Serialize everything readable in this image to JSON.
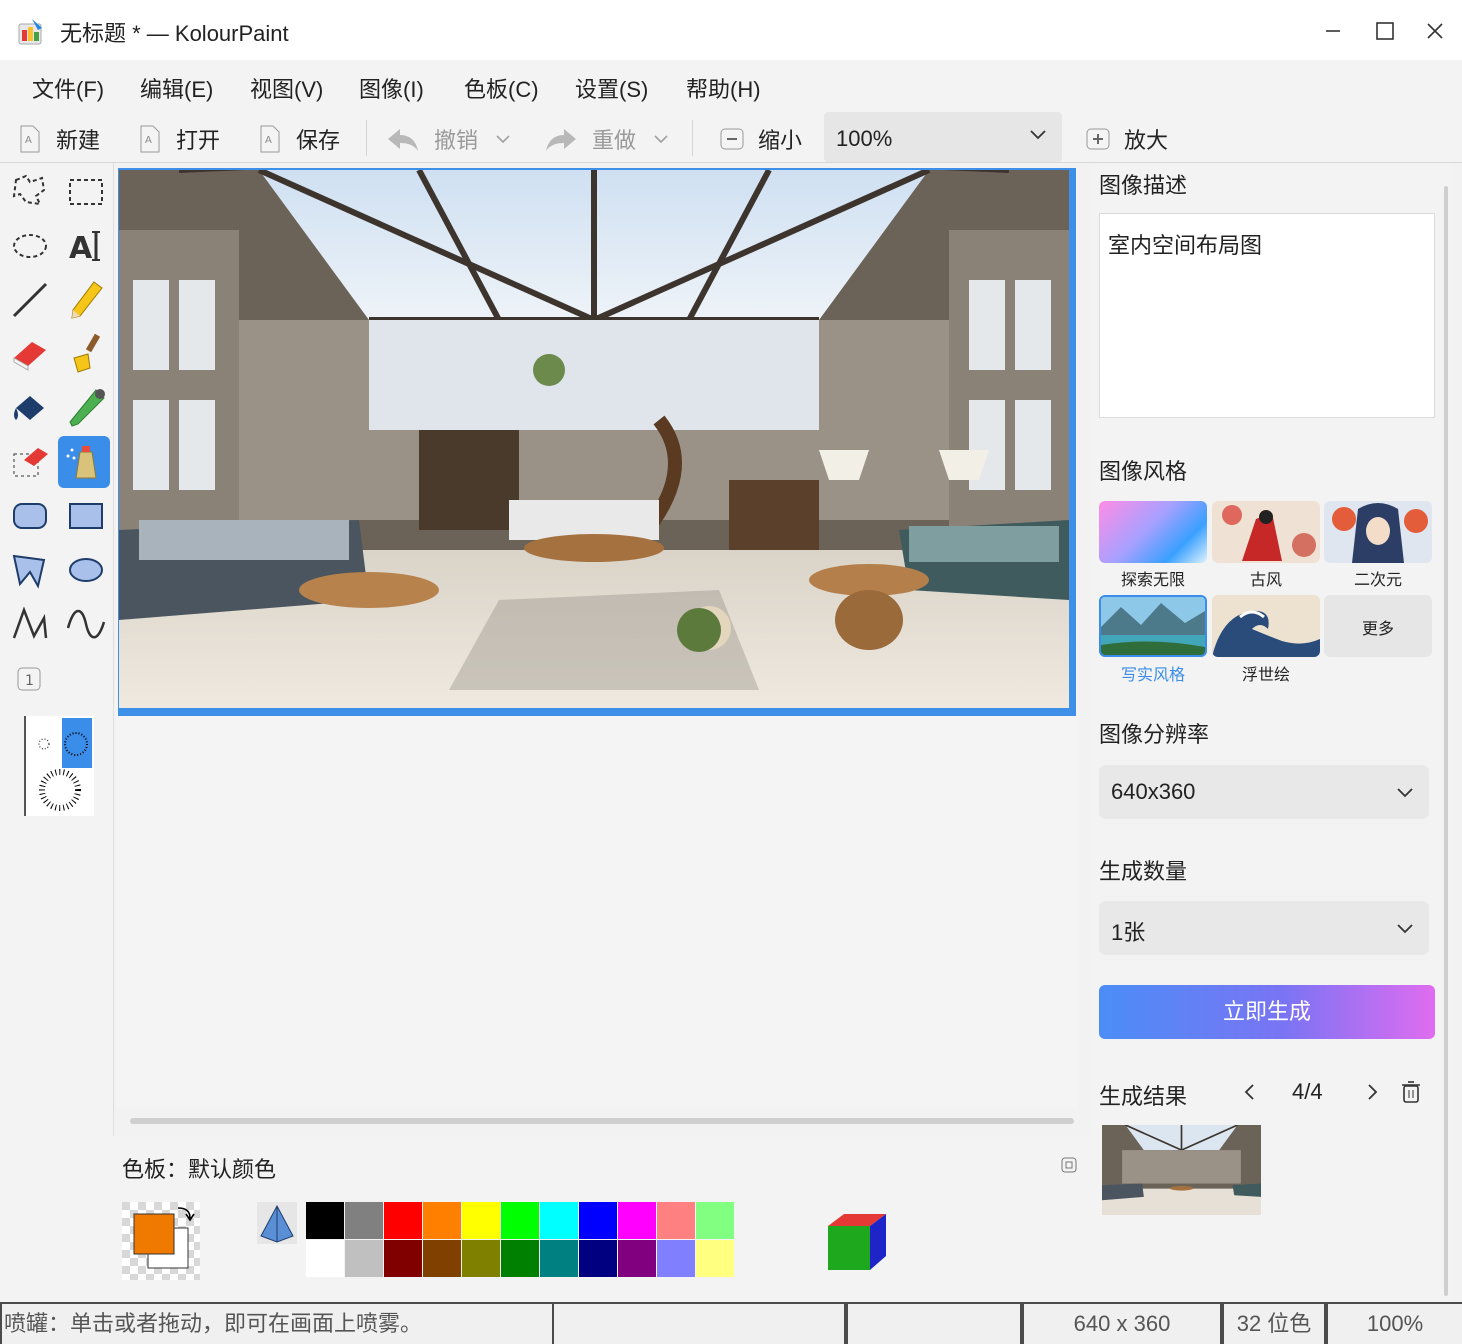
{
  "window": {
    "title": "无标题 * — KolourPaint",
    "controls": [
      "minimize",
      "maximize",
      "close"
    ]
  },
  "menu": [
    "文件(F)",
    "编辑(E)",
    "视图(V)",
    "图像(I)",
    "色板(C)",
    "设置(S)",
    "帮助(H)"
  ],
  "toolbar": {
    "new_label": "新建",
    "open_label": "打开",
    "save_label": "保存",
    "undo_label": "撤销",
    "redo_label": "重做",
    "zoom_out_label": "缩小",
    "zoom_value": "100%",
    "zoom_in_label": "放大"
  },
  "tools": [
    "free-form-select",
    "rectangle-select",
    "ellipse-select",
    "text",
    "line",
    "pen",
    "eraser",
    "brush",
    "flood-fill",
    "color-picker",
    "color-eraser",
    "spraycan",
    "rounded-rectangle",
    "rectangle",
    "polygon",
    "ellipse",
    "connected-lines",
    "curve"
  ],
  "active_tool": "spraycan",
  "palette": {
    "label": "色板：默认颜色",
    "foreground": "#f07a00",
    "background": "#ffffff",
    "colors_top": [
      "#000000",
      "#808080",
      "#ff0000",
      "#ff8000",
      "#ffff00",
      "#00ff00",
      "#00ffff",
      "#0000ff",
      "#ff00ff",
      "#ff8080",
      "#80ff80"
    ],
    "colors_bottom": [
      "#ffffff",
      "#c0c0c0",
      "#800000",
      "#804000",
      "#808000",
      "#008000",
      "#008080",
      "#000080",
      "#800080",
      "#8080ff",
      "#ffff80"
    ]
  },
  "side_panel": {
    "desc_title": "图像描述",
    "desc_text": "室内空间布局图",
    "style_title": "图像风格",
    "styles": [
      {
        "label": "探索无限",
        "selected": false
      },
      {
        "label": "古风",
        "selected": false
      },
      {
        "label": "二次元",
        "selected": false
      },
      {
        "label": "写实风格",
        "selected": true
      },
      {
        "label": "浮世绘",
        "selected": false
      },
      {
        "label": "更多",
        "selected": false
      }
    ],
    "resolution_title": "图像分辨率",
    "resolution_value": "640x360",
    "count_title": "生成数量",
    "count_value": "1张",
    "generate_label": "立即生成",
    "results_title": "生成结果",
    "results_page": "4/4"
  },
  "status": {
    "message": "喷罐：单击或者拖动，即可在画面上喷雾。",
    "dimensions": "640 x 360",
    "color_depth": "32 位色",
    "zoom": "100%"
  },
  "accent_color": "#3a8de8"
}
